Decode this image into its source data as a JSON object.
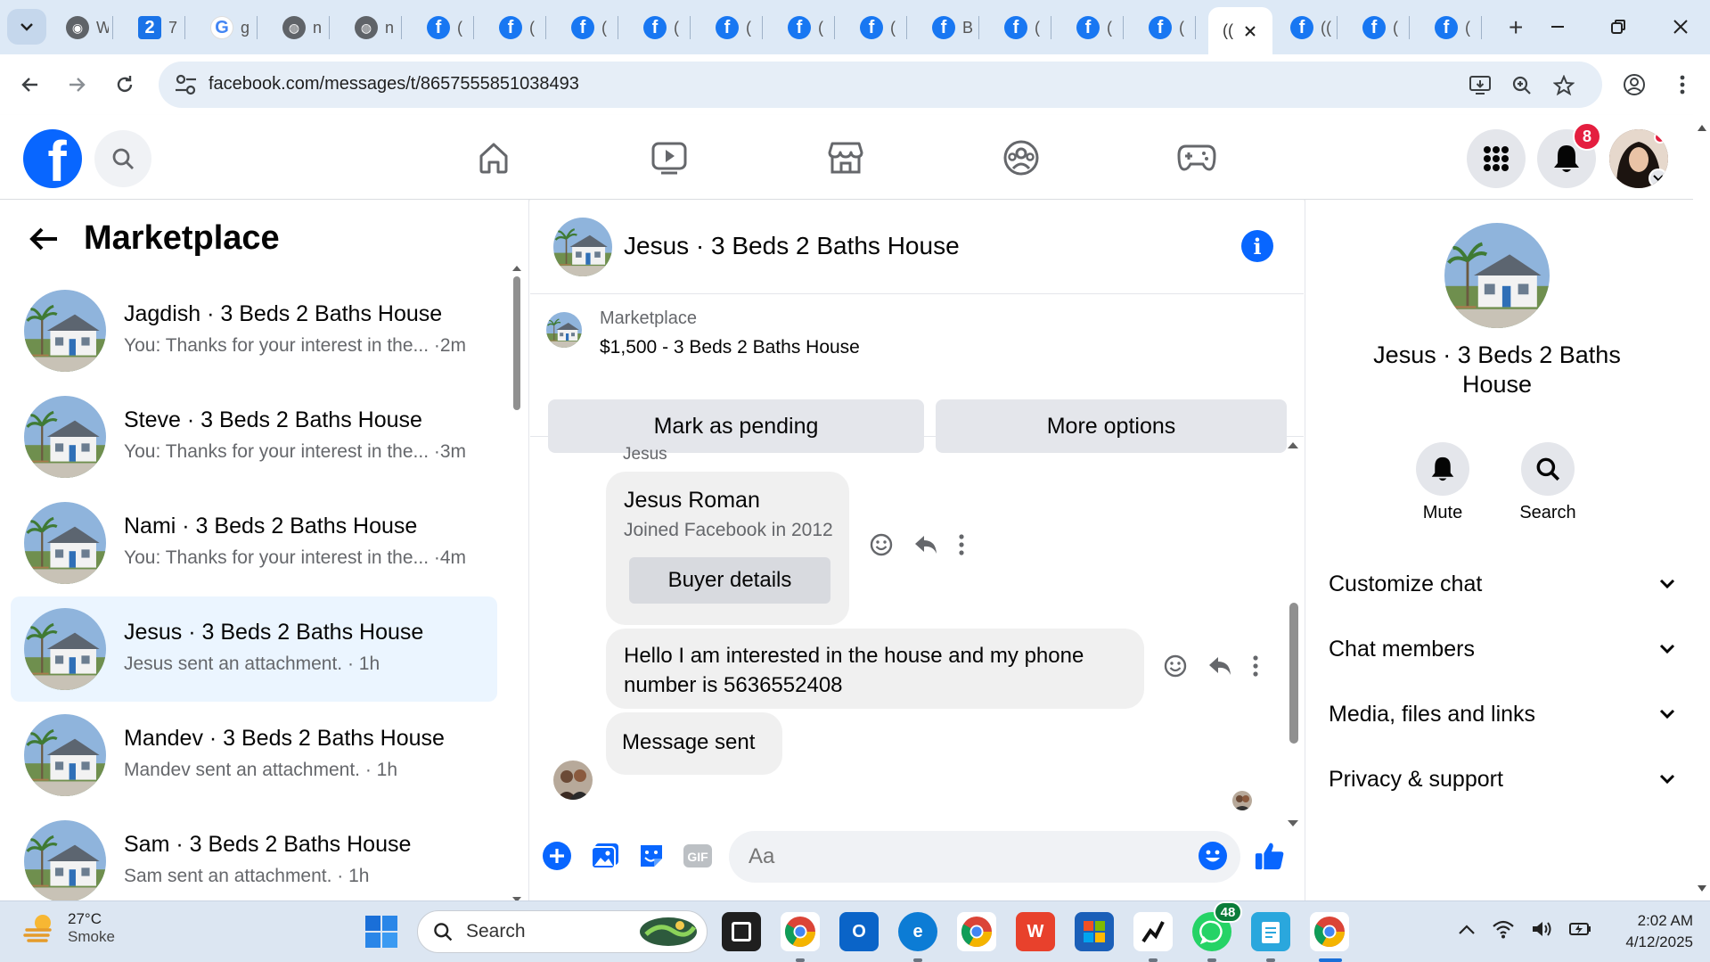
{
  "browser": {
    "tabs": [
      {
        "icon": "chrome-shield-icon",
        "title": "W"
      },
      {
        "icon": "docs-icon",
        "title": "7"
      },
      {
        "icon": "google-icon",
        "title": "g"
      },
      {
        "icon": "globe-icon",
        "title": "n"
      },
      {
        "icon": "globe-icon",
        "title": "n"
      },
      {
        "icon": "facebook-icon",
        "title": "("
      },
      {
        "icon": "facebook-icon",
        "title": "("
      },
      {
        "icon": "facebook-icon",
        "title": "("
      },
      {
        "icon": "facebook-icon",
        "title": "("
      },
      {
        "icon": "facebook-icon",
        "title": "("
      },
      {
        "icon": "facebook-icon",
        "title": "("
      },
      {
        "icon": "facebook-icon",
        "title": "("
      },
      {
        "icon": "facebook-icon",
        "title": "B"
      },
      {
        "icon": "facebook-icon",
        "title": "("
      },
      {
        "icon": "facebook-icon",
        "title": "("
      },
      {
        "icon": "facebook-icon",
        "title": "("
      },
      {
        "icon": "facebook-icon",
        "title": "(("
      },
      {
        "icon": "facebook-icon",
        "title": "("
      },
      {
        "icon": "facebook-icon",
        "title": "("
      }
    ],
    "active_tab_title": "((",
    "new_tab": "+",
    "url": "facebook.com/messages/t/8657555851038493"
  },
  "fb": {
    "notifications_count": "8",
    "marketplace_title": "Marketplace",
    "conversations": [
      {
        "name": "Jagdish · 3 Beds 2 Baths House",
        "snippet": "You: Thanks for your interest in the... ·2m",
        "selected": false
      },
      {
        "name": "Steve · 3 Beds 2 Baths House",
        "snippet": "You: Thanks for your interest in the... ·3m",
        "selected": false
      },
      {
        "name": "Nami · 3 Beds 2 Baths House",
        "snippet": "You: Thanks for your interest in the... ·4m",
        "selected": false
      },
      {
        "name": "Jesus · 3 Beds 2 Baths House",
        "snippet": "Jesus sent an attachment. · 1h",
        "selected": true
      },
      {
        "name": "Mandev · 3 Beds 2 Baths House",
        "snippet": "Mandev sent an attachment. · 1h",
        "selected": false
      },
      {
        "name": "Sam · 3 Beds 2 Baths House",
        "snippet": "Sam sent an attachment. · 1h",
        "selected": false
      }
    ],
    "chat": {
      "title": "Jesus · 3 Beds 2 Baths House",
      "listing_label": "Marketplace",
      "listing_price": "$1,500 - 3 Beds 2 Baths House",
      "mark_pending": "Mark as pending",
      "more_options": "More options",
      "sender_label": "Jesus",
      "card_name": "Jesus Roman",
      "card_joined": "Joined Facebook in 2012",
      "buyer_details": "Buyer details",
      "message_line1": "Hello I am interested in the house and my phone",
      "message_line2": "number is 5636552408",
      "message_sent": "Message sent",
      "composer_placeholder": "Aa"
    },
    "right": {
      "name": "Jesus · 3 Beds 2 Baths House",
      "mute": "Mute",
      "search": "Search",
      "sections": [
        "Customize chat",
        "Chat members",
        "Media, files and links",
        "Privacy & support"
      ]
    }
  },
  "taskbar": {
    "temp": "27°C",
    "weather": "Smoke",
    "search_label": "Search",
    "whatsapp_badge": "48",
    "time": "2:02 AM",
    "date": "4/12/2025"
  },
  "colors": {
    "fb_blue": "#0866ff",
    "selected_row": "#ebf5ff",
    "bubble": "#f0f0f0",
    "badge_red": "#e41e3f"
  }
}
